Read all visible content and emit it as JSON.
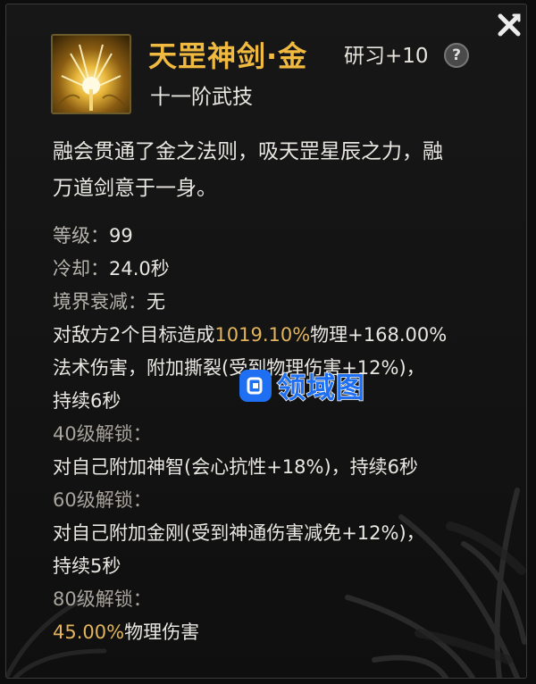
{
  "skill": {
    "name": "天罡神剑·金",
    "research": "研习+10",
    "help": "?",
    "rank": "十一阶武技",
    "description_line1": "融会贯通了金之法则，吸天罡星辰之力，融",
    "description_line2": "万道剑意于一身。"
  },
  "stats": {
    "level_label": "等级：",
    "level_value": "99",
    "cooldown_label": "冷却：",
    "cooldown_value": "24.0秒",
    "decay_label": "境界衰减：",
    "decay_value": "无",
    "effect_a": "对敌方2个目标造成",
    "effect_pct1": "1019.10%",
    "effect_b": "物理+168.00%",
    "effect_line2": "法术伤害，附加撕裂(受到物理伤害+12%)，",
    "effect_line3": "持续6秒"
  },
  "unlocks": [
    {
      "header": "40级解锁：",
      "line1": "对自己附加神智(会心抗性+18%)，持续6秒",
      "line2": ""
    },
    {
      "header": "60级解锁：",
      "line1": "对自己附加金刚(受到神通伤害减免+12%)，",
      "line2": "持续5秒"
    },
    {
      "header": "80级解锁：",
      "pct": "45.00%",
      "rest": "物理伤害"
    }
  ],
  "watermark": {
    "text": "领域图"
  },
  "colors": {
    "title": "#f0b93f",
    "highlight": "#e2b45d",
    "watermark": "#1e6ff2"
  },
  "icons": {
    "close": "close-x-icon",
    "help": "question-mark-icon",
    "skill": "golden-sword-skill-icon"
  }
}
